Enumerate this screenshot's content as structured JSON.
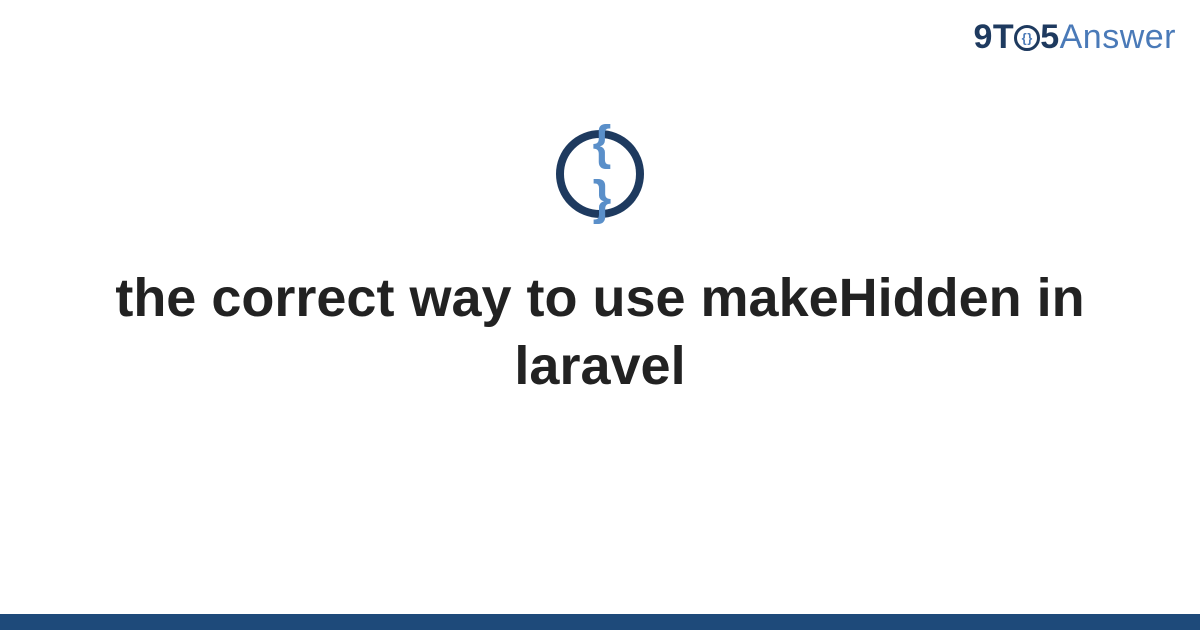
{
  "brand": {
    "prefix": "9T",
    "middle_inner": "{}",
    "suffix_num": "5",
    "suffix_word": "Answer"
  },
  "topic_icon": {
    "glyph": "{ }",
    "name": "code-braces-icon"
  },
  "title": "the correct way to use makeHidden in laravel",
  "colors": {
    "brand_dark": "#1e3a5f",
    "brand_light": "#4a7ab8",
    "icon_ring": "#1e3a5f",
    "icon_glyph": "#5a8fc9",
    "footer": "#1e4a7a",
    "text": "#222222"
  }
}
